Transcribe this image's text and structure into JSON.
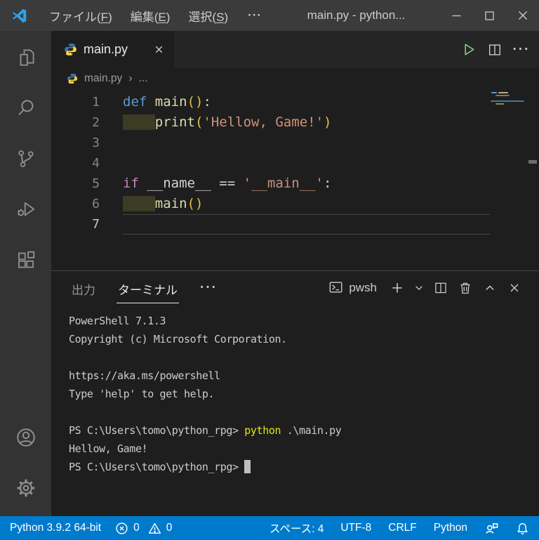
{
  "palette": {
    "keyword": "#569CD6",
    "control": "#C586C0",
    "function": "#DCDCAA",
    "string": "#CE9178",
    "bracket": "#E2C23A",
    "plain": "#D4D4D4",
    "indent": "#3B3B26",
    "cmdYellow": "#E5E510",
    "statusbar": "#007ACC",
    "titlebar": "#3B3B3B",
    "activitybar": "#333333",
    "editor_bg": "#1E1E1E",
    "tabbar_bg": "#252526",
    "run_green": "#89D185"
  },
  "titlebar": {
    "menus": [
      {
        "pre": "ファイル(",
        "key": "F",
        "post": ")"
      },
      {
        "pre": "編集(",
        "key": "E",
        "post": ")"
      },
      {
        "pre": "選択(",
        "key": "S",
        "post": ")"
      }
    ],
    "overflow": "···",
    "title": "main.py - python..."
  },
  "editor": {
    "tab": {
      "label": "main.py"
    },
    "breadcrumb": {
      "file": "main.py",
      "sep": "›",
      "more": "..."
    },
    "lines": [
      {
        "num": "1",
        "segs": [
          {
            "t": "def",
            "c": "keyword"
          },
          {
            "t": " ",
            "c": "plain"
          },
          {
            "t": "main",
            "c": "function"
          },
          {
            "t": "()",
            "c": "bracket"
          },
          {
            "t": ":",
            "c": "plain"
          }
        ]
      },
      {
        "num": "2",
        "segs": [
          {
            "t": "    ",
            "bg": "indent"
          },
          {
            "t": "print",
            "c": "function"
          },
          {
            "t": "(",
            "c": "bracket"
          },
          {
            "t": "'Hellow, Game!'",
            "c": "string"
          },
          {
            "t": ")",
            "c": "bracket"
          }
        ]
      },
      {
        "num": "3",
        "segs": []
      },
      {
        "num": "4",
        "segs": []
      },
      {
        "num": "5",
        "segs": [
          {
            "t": "if",
            "c": "control"
          },
          {
            "t": " __name__ == ",
            "c": "plain"
          },
          {
            "t": "'__main__'",
            "c": "string"
          },
          {
            "t": ":",
            "c": "plain"
          }
        ]
      },
      {
        "num": "6",
        "segs": [
          {
            "t": "    ",
            "bg": "indent"
          },
          {
            "t": "main",
            "c": "function"
          },
          {
            "t": "()",
            "c": "bracket"
          }
        ]
      },
      {
        "num": "7",
        "segs": [],
        "current": true
      }
    ]
  },
  "panel": {
    "tabs": [
      {
        "label": "出力",
        "active": false
      },
      {
        "label": "ターミナル",
        "active": true
      }
    ],
    "more": "···",
    "shell": "pwsh",
    "terminal": [
      {
        "segs": [
          {
            "t": "PowerShell 7.1.3"
          }
        ]
      },
      {
        "segs": [
          {
            "t": "Copyright (c) Microsoft Corporation."
          }
        ]
      },
      {
        "segs": []
      },
      {
        "segs": [
          {
            "t": "https://aka.ms/powershell"
          }
        ]
      },
      {
        "segs": [
          {
            "t": "Type 'help' to get help."
          }
        ]
      },
      {
        "segs": []
      },
      {
        "segs": [
          {
            "t": "PS C:\\Users\\tomo\\python_rpg> "
          },
          {
            "t": "python",
            "c": "cmdYellow"
          },
          {
            "t": " .\\main.py"
          }
        ]
      },
      {
        "segs": [
          {
            "t": "Hellow, Game!"
          }
        ]
      },
      {
        "segs": [
          {
            "t": "PS C:\\Users\\tomo\\python_rpg> "
          },
          {
            "cursor": true
          }
        ]
      }
    ]
  },
  "statusbar": {
    "interpreter": "Python 3.9.2 64-bit",
    "errors": "0",
    "warnings": "0",
    "spaces": "スペース: 4",
    "encoding": "UTF-8",
    "eol": "CRLF",
    "language": "Python"
  }
}
